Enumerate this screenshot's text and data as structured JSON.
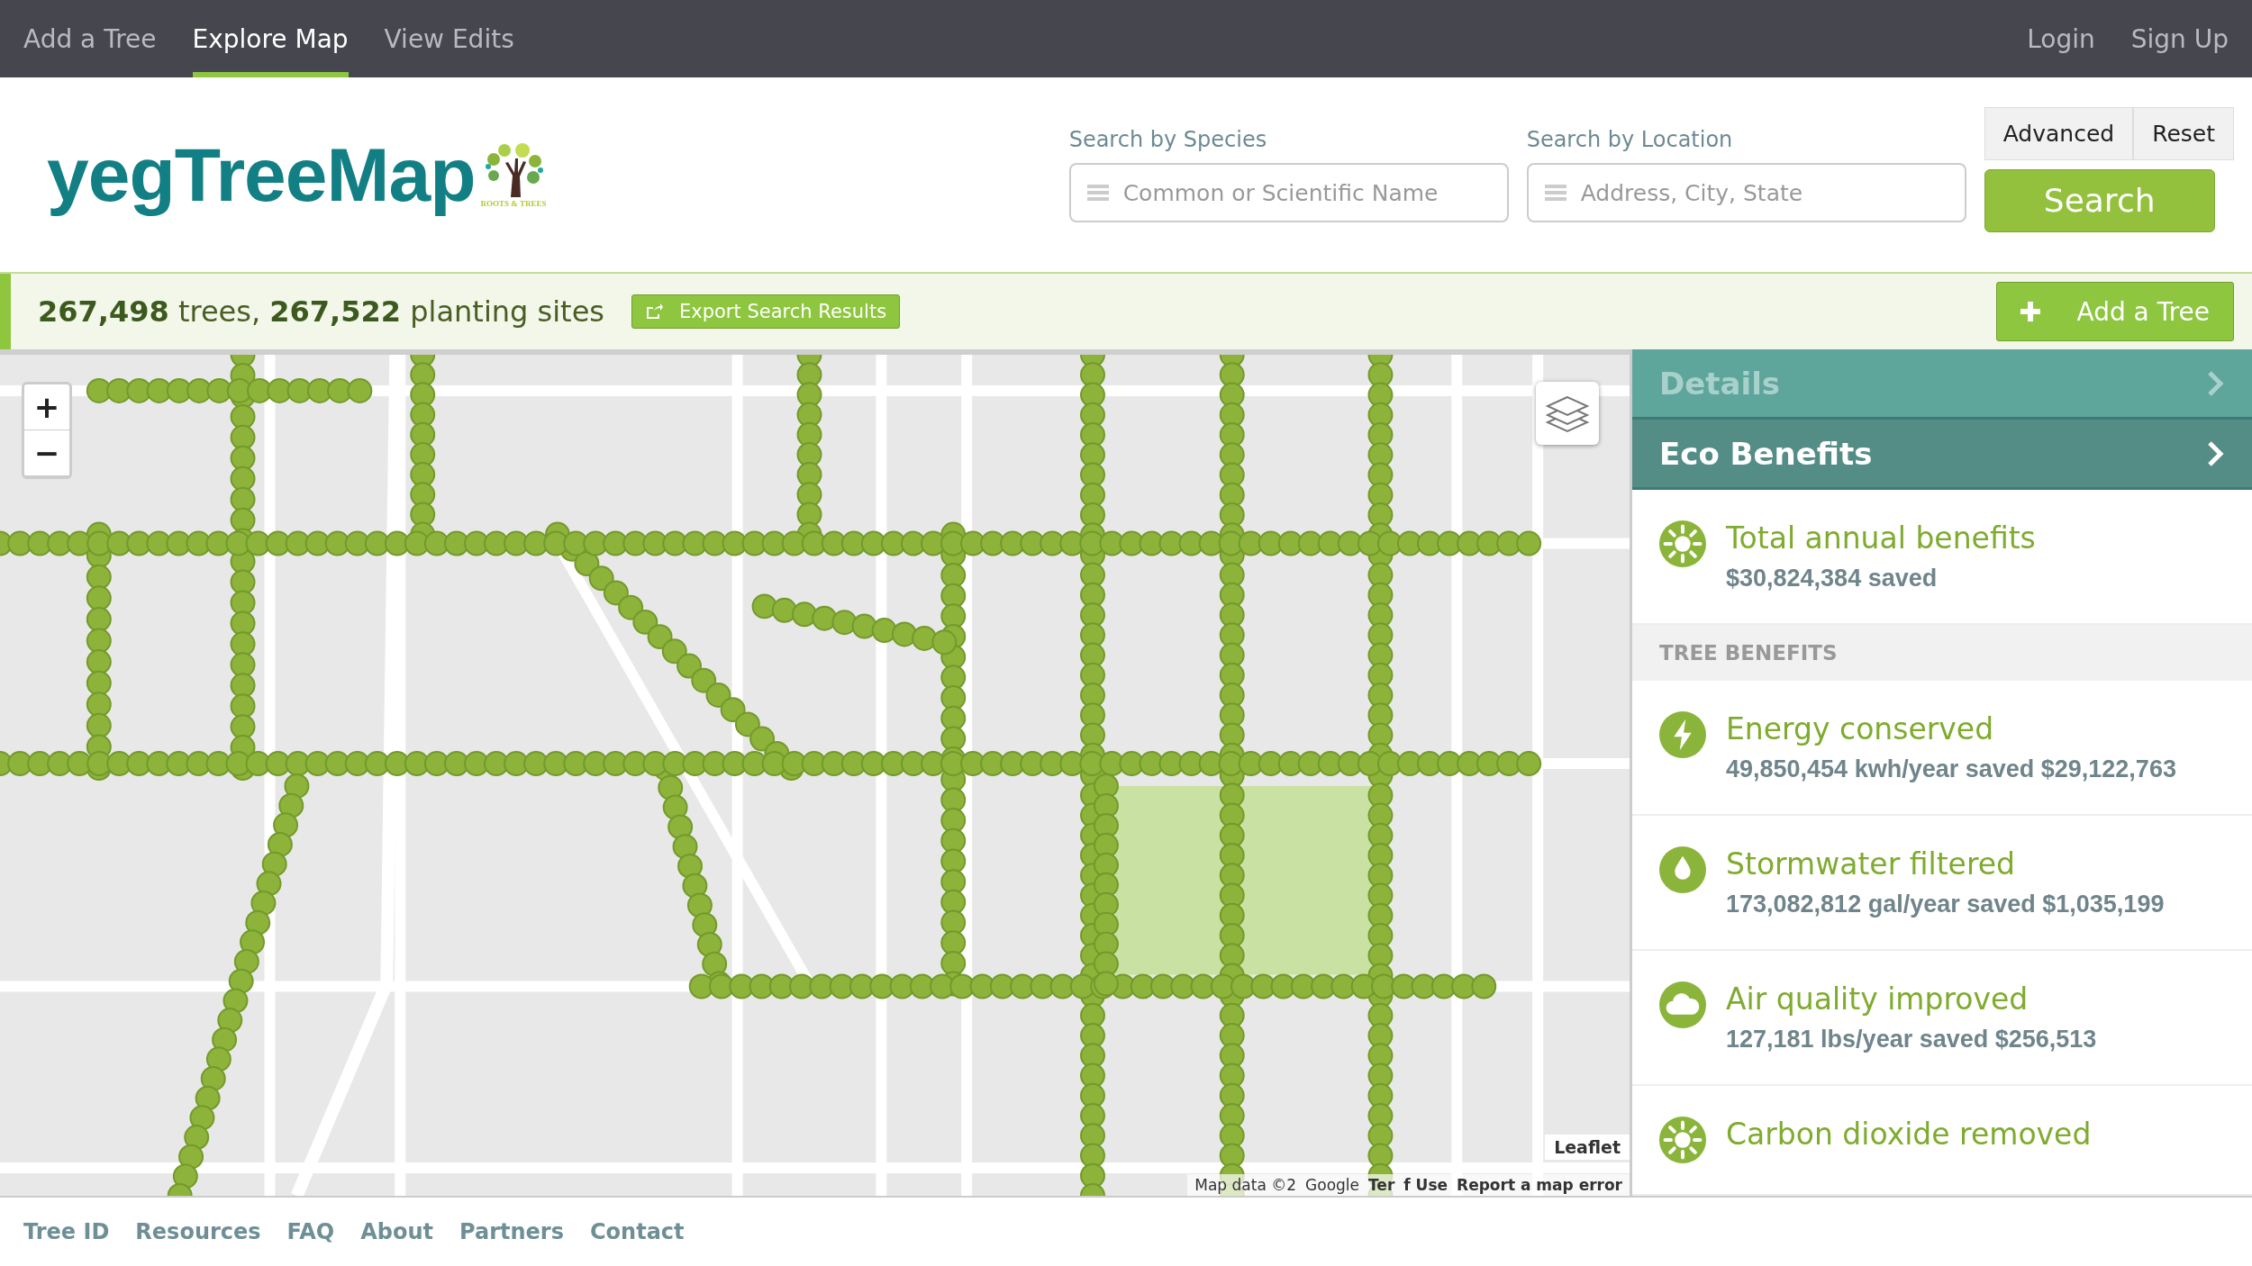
{
  "nav": {
    "items": [
      {
        "label": "Add a Tree",
        "selected": false
      },
      {
        "label": "Explore Map",
        "selected": true
      },
      {
        "label": "View Edits",
        "selected": false
      }
    ],
    "auth": [
      "Login",
      "Sign Up"
    ]
  },
  "header": {
    "logo": "yegTreeMap",
    "logo_caption": "ROOTS & TREES",
    "search": [
      {
        "label": "Search by Species",
        "placeholder": "Common or Scientific Name"
      },
      {
        "label": "Search by Location",
        "placeholder": "Address, City, State"
      }
    ],
    "advanced": "Advanced",
    "reset": "Reset",
    "search_button": "Search"
  },
  "stats": {
    "summary": "**267,498** trees, **267,522** planting sites",
    "export": "Export Search Results",
    "add_tree": "Add a Tree"
  },
  "map": {
    "zoom_in": "+",
    "zoom_out": "−",
    "attribution": [
      "Map data ©2",
      "Google",
      "Ter",
      "f Use",
      "Report a map error"
    ],
    "leaflet": "Leaflet"
  },
  "panel": {
    "sections": [
      {
        "title": "Details",
        "selected": false
      },
      {
        "title": "Eco Benefits",
        "selected": true
      }
    ],
    "total": {
      "kind": "sun",
      "title": "Total annual benefits",
      "value": "$30,824,384 saved"
    },
    "group": "TREE BENEFITS",
    "benefits": [
      {
        "kind": "bolt",
        "title": "Energy conserved",
        "value": "49,850,454 kwh/year saved $29,122,763"
      },
      {
        "kind": "drop",
        "title": "Stormwater filtered",
        "value": "173,082,812 gal/year saved $1,035,199"
      },
      {
        "kind": "cloud",
        "title": "Air quality improved",
        "value": "127,181 lbs/year saved $256,513"
      },
      {
        "kind": "sun",
        "title": "Carbon dioxide removed"
      }
    ]
  },
  "footer": [
    "Tree ID",
    "Resources",
    "FAQ",
    "About",
    "Partners",
    "Contact"
  ]
}
